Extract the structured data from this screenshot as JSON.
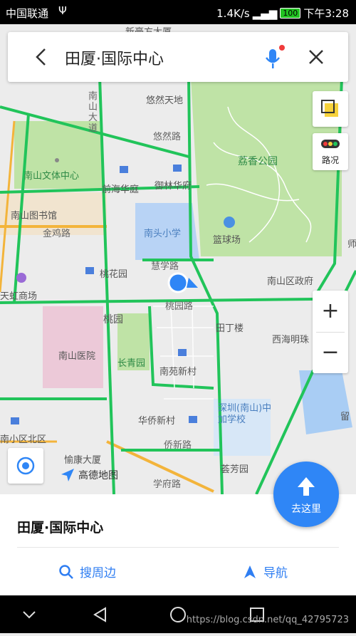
{
  "status_bar": {
    "carrier": "中国联通",
    "usb": "Ψ",
    "speed": "1.4K/s",
    "battery": "100",
    "time": "下午3:28"
  },
  "search": {
    "title": "田厦·国际中心"
  },
  "map_controls": {
    "traffic_label": "路况",
    "zoom_in": "+",
    "zoom_out": "−"
  },
  "map_labels": {
    "youran": "悠然天地",
    "youran_rd": "悠然路",
    "nanshan_avenue": "南山大道",
    "lizhi_park": "荔香公园",
    "culture_center": "南山文体中心",
    "qianhai_huating": "前海华庭",
    "yulin_huating": "御林华府",
    "library": "南山图书馆",
    "jinji_rd": "金鸡路",
    "nantou_school": "南头小学",
    "basketball": "篮球场",
    "taohua_garden": "桃花园",
    "huixue_rd": "慧学路",
    "tianhong": "天虹商场",
    "district_gov": "南山区政府",
    "taoyuan_rd": "桃园路",
    "taoyuan": "桃园",
    "tianding": "田丁楼",
    "hospital": "南山医院",
    "changqing": "长青园",
    "nanyuan": "南苑新村",
    "xihai": "西海明珠",
    "huaqiao": "华侨新村",
    "zhongjia": "深圳(南山)中加学校",
    "qiaoxin_rd": "侨新路",
    "nanshan_n": "南小区北区",
    "yukang": "愉康大厦",
    "xuefu_rd": "学府路",
    "yunfang": "荟芳园",
    "liu": "留",
    "shi": "师",
    "top_cut": "新豪方大厦"
  },
  "logo_text": "高德地图",
  "bottom_sheet": {
    "place_name": "田厦·国际中心",
    "search_nearby": "搜周边",
    "navigate": "导航",
    "go_here": "去这里"
  },
  "watermark": "https://blog.csdn.net/qq_42795723",
  "colors": {
    "road_green": "#21c45a",
    "road_yellow": "#f3b43b",
    "park_green": "#bfe3a6",
    "water_blue": "#a9cdf4",
    "accent_blue": "#2f86f6"
  }
}
